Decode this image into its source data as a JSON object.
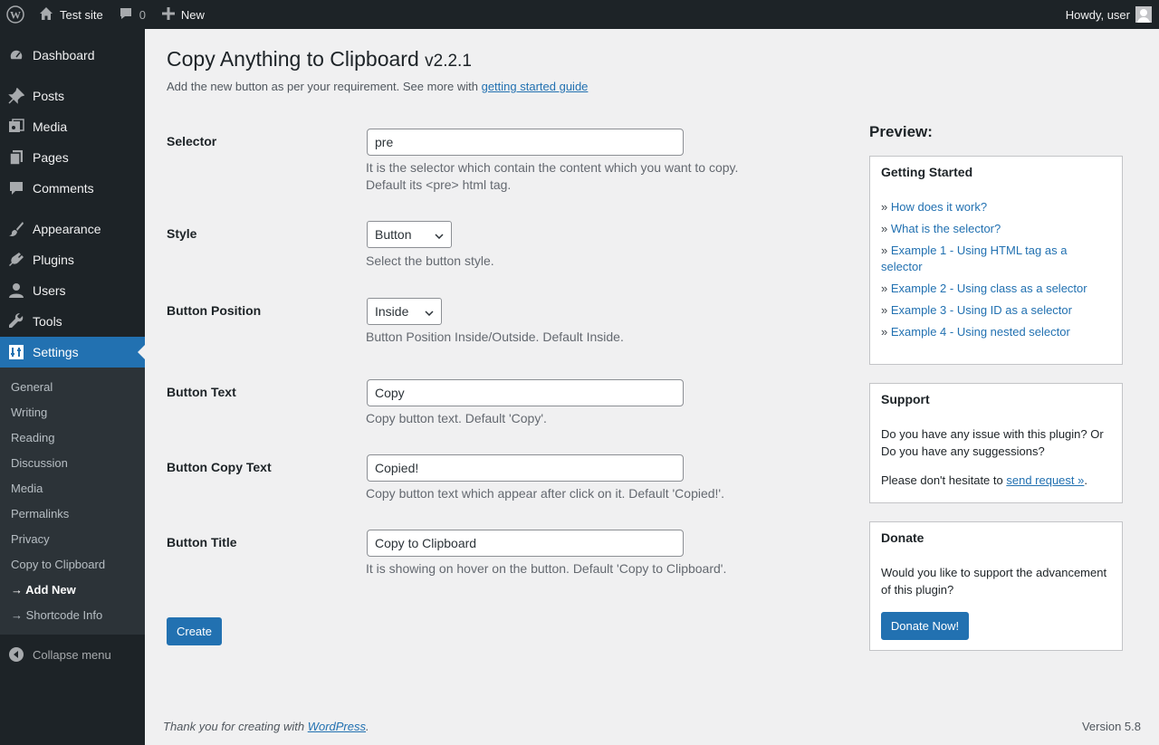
{
  "adminbar": {
    "site_name": "Test site",
    "comment_count": "0",
    "new_label": "New",
    "howdy": "Howdy, user"
  },
  "sidebar": {
    "items": [
      {
        "label": "Dashboard",
        "icon": "dashboard-icon"
      },
      {
        "label": "Posts",
        "icon": "pin-icon"
      },
      {
        "label": "Media",
        "icon": "media-icon"
      },
      {
        "label": "Pages",
        "icon": "pages-icon"
      },
      {
        "label": "Comments",
        "icon": "comment-icon"
      },
      {
        "label": "Appearance",
        "icon": "brush-icon"
      },
      {
        "label": "Plugins",
        "icon": "plug-icon"
      },
      {
        "label": "Users",
        "icon": "user-icon"
      },
      {
        "label": "Tools",
        "icon": "wrench-icon"
      },
      {
        "label": "Settings",
        "icon": "settings-icon"
      }
    ],
    "submenu": [
      "General",
      "Writing",
      "Reading",
      "Discussion",
      "Media",
      "Permalinks",
      "Privacy",
      "Copy to Clipboard",
      "→ Add New",
      "→ Shortcode Info"
    ],
    "collapse_label": "Collapse menu"
  },
  "page": {
    "title": "Copy Anything to Clipboard",
    "version": "v2.2.1",
    "description": "Add the new button as per your requirement. See more with ",
    "guide_link": "getting started guide"
  },
  "form": {
    "selector": {
      "label": "Selector",
      "value": "pre",
      "help1": "It is the selector which contain the content which you want to copy.",
      "help2": "Default its <pre> html tag."
    },
    "style": {
      "label": "Style",
      "value": "Button",
      "help": "Select the button style."
    },
    "position": {
      "label": "Button Position",
      "value": "Inside",
      "help": "Button Position Inside/Outside. Default Inside."
    },
    "button_text": {
      "label": "Button Text",
      "value": "Copy",
      "help": "Copy button text. Default 'Copy'."
    },
    "copy_text": {
      "label": "Button Copy Text",
      "value": "Copied!",
      "help": "Copy button text which appear after click on it. Default 'Copied!'."
    },
    "title": {
      "label": "Button Title",
      "value": "Copy to Clipboard",
      "help": "It is showing on hover on the button. Default 'Copy to Clipboard'."
    },
    "submit": "Create"
  },
  "preview": {
    "heading": "Preview:",
    "getting_started": {
      "title": "Getting Started",
      "links": [
        "How does it work?",
        "What is the selector?",
        "Example 1 - Using HTML tag as a selector",
        "Example 2 - Using class as a selector",
        "Example 3 - Using ID as a selector",
        "Example 4 - Using nested selector"
      ]
    },
    "support": {
      "title": "Support",
      "text": "Do you have any issue with this plugin? Or Do you have any suggessions?",
      "text2_prefix": "Please don't hesitate to ",
      "link": "send request »",
      "text2_suffix": "."
    },
    "donate": {
      "title": "Donate",
      "text": "Would you like to support the advancement of this plugin?",
      "button": "Donate Now!"
    }
  },
  "footer": {
    "thanks_prefix": "Thank you for creating with ",
    "wp_link": "WordPress",
    "thanks_suffix": ".",
    "version": "Version 5.8"
  },
  "colors": {
    "accent": "#2271b1",
    "adminbar": "#1d2327",
    "submenu": "#2c3338",
    "background": "#f0f0f1"
  }
}
